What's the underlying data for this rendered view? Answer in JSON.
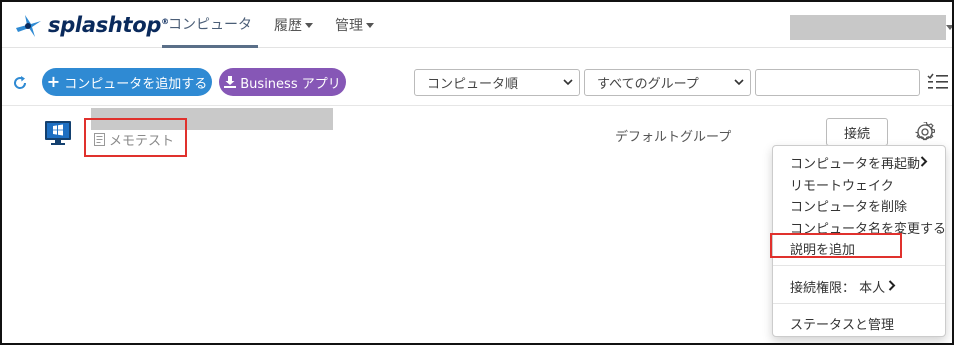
{
  "header": {
    "logo_text": "splashtop",
    "logo_mark": "®",
    "nav": [
      {
        "label": "コンピュータ",
        "active": true
      },
      {
        "label": "履歴",
        "dropdown": true
      },
      {
        "label": "管理",
        "dropdown": true
      }
    ]
  },
  "toolbar": {
    "add_computer_label": "コンピュータを追加する",
    "business_app_label": "Business アプリ",
    "sort_select": {
      "selected": "コンピュータ順"
    },
    "group_select": {
      "selected": "すべてのグループ"
    },
    "search": {
      "value": "",
      "placeholder": ""
    }
  },
  "computer": {
    "memo": "メモテスト",
    "group": "デフォルトグループ",
    "connect_label": "接続"
  },
  "menu": {
    "items": [
      {
        "label": "コンピュータを再起動",
        "submenu": true
      },
      {
        "label": "リモートウェイク"
      },
      {
        "label": "コンピュータを削除"
      },
      {
        "label": "コンピュータ名を変更する"
      },
      {
        "label": "説明を追加",
        "highlighted": true
      }
    ],
    "permission_label": "接続権限：",
    "permission_value": "本人",
    "status_label": "ステータスと管理"
  },
  "colors": {
    "primary": "#2f8ad3",
    "business": "#8657b6",
    "highlight": "#e0312d",
    "logo": "#0a2a5c",
    "windows_blue": "#1e6fc2"
  },
  "icons": [
    "splashtop-logo-icon",
    "refresh-icon",
    "download-icon",
    "list-view-icon",
    "windows-computer-icon",
    "memo-icon",
    "gear-icon",
    "chevron-right-icon"
  ]
}
